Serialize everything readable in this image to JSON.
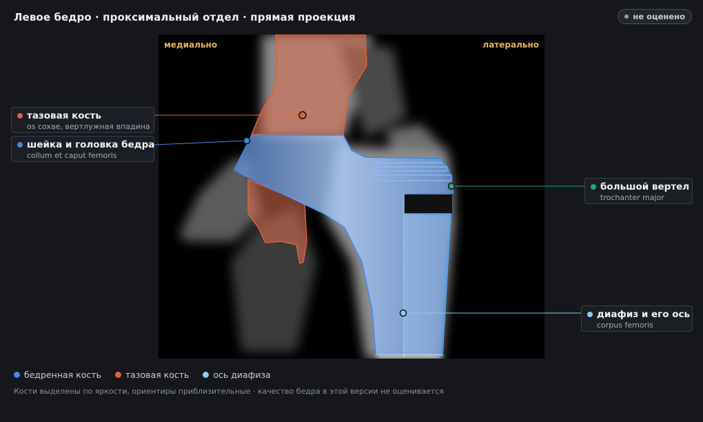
{
  "header": {
    "title": "Левое бедро · проксимальный отдел · прямая проекция",
    "status_badge": "не оценено"
  },
  "viewer": {
    "orientation_left": "медиально",
    "orientation_right": "латерально"
  },
  "callouts": {
    "pelvis": {
      "title": "тазовая кость",
      "subtitle": "os coxae, вертлужная впадина",
      "color": "#e0623a"
    },
    "neck": {
      "title": "шейка и головка бедра",
      "subtitle": "collum et caput femoris",
      "color": "#3f8ae6"
    },
    "trochanter": {
      "title": "большой вертел",
      "subtitle": "trochanter major",
      "color": "#2aa37c"
    },
    "shaft": {
      "title": "диафиз и его ось",
      "subtitle": "corpus femoris",
      "color": "#7fd0f5"
    }
  },
  "legend": [
    {
      "label": "бедренная кость",
      "color": "#3f8ae6"
    },
    {
      "label": "тазовая кость",
      "color": "#e0623a"
    },
    {
      "label": "ось диафиза",
      "color": "#7fd0f5"
    }
  ],
  "footnote": "Кости выделены по яркости, ориентиры приблизительные · качество бедра в этой версии не оценивается"
}
